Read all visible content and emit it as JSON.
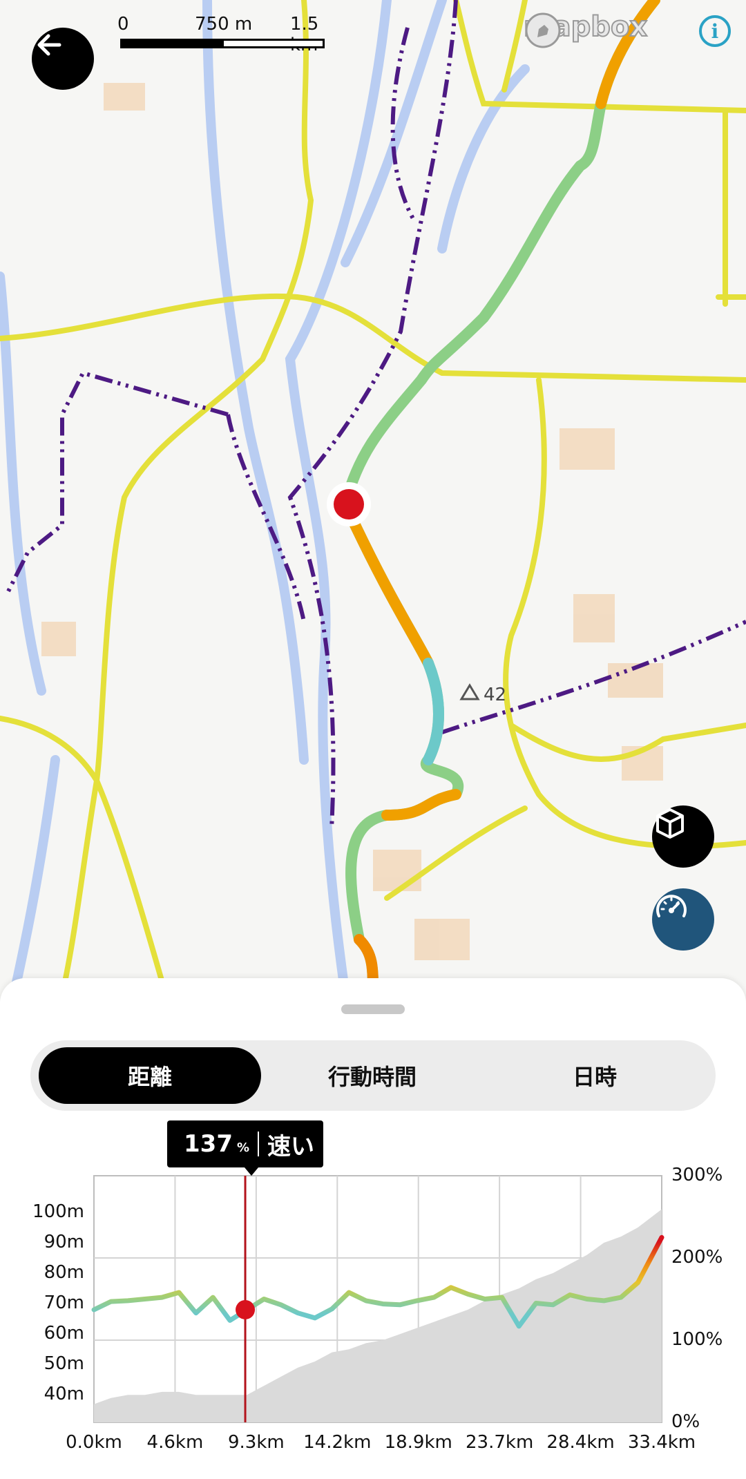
{
  "map": {
    "scale": {
      "labels": [
        "0",
        "750 m",
        "1.5 km"
      ]
    },
    "attribution": {
      "logo_text": "mapbox",
      "info_icon": "info-icon"
    },
    "landmark": {
      "icon": "triangle-peak-icon",
      "label": "42"
    },
    "buttons": {
      "back": "arrow-left-icon",
      "view3d": "cube-icon",
      "speed": "speedometer-icon"
    }
  },
  "sheet": {
    "tabs": [
      {
        "label": "距離",
        "active": true
      },
      {
        "label": "行動時間",
        "active": false
      },
      {
        "label": "日時",
        "active": false
      }
    ],
    "tooltip": {
      "percent": "137",
      "unit": "%",
      "speed_label": "速い"
    }
  },
  "chart_data": {
    "type": "line",
    "x_labels": [
      "0.0km",
      "4.6km",
      "9.3km",
      "14.2km",
      "18.9km",
      "23.7km",
      "28.4km",
      "33.4km"
    ],
    "y_left_labels": [
      "100m",
      "90m",
      "80m",
      "70m",
      "60m",
      "50m",
      "40m"
    ],
    "y_right_labels": [
      "300%",
      "200%",
      "100%",
      "0%"
    ],
    "xlim_km": [
      0,
      33.4
    ],
    "ylim_left_m": [
      31,
      112
    ],
    "ylim_right_pct": [
      0,
      300
    ],
    "cursor_km": 8.9,
    "cursor_pct": 137,
    "series": [
      {
        "axis": "right",
        "km": [
          0,
          1,
          2,
          3,
          4,
          5,
          6,
          7,
          8,
          9,
          10,
          11,
          12,
          13,
          14,
          15,
          16,
          17,
          18,
          19,
          20,
          21,
          22,
          23,
          24,
          25,
          26,
          27,
          28,
          29,
          30,
          31,
          32,
          33.4
        ],
        "pct": [
          137,
          147,
          148,
          150,
          152,
          158,
          133,
          152,
          124,
          137,
          150,
          143,
          133,
          127,
          138,
          158,
          148,
          144,
          143,
          148,
          152,
          164,
          156,
          150,
          152,
          117,
          145,
          143,
          155,
          150,
          148,
          152,
          170,
          225
        ]
      },
      {
        "axis": "left",
        "km": [
          0,
          1,
          2,
          3,
          4,
          5,
          6,
          7,
          8,
          9,
          10,
          11,
          12,
          13,
          14,
          15,
          16,
          17,
          18,
          19,
          20,
          21,
          22,
          23,
          24,
          25,
          26,
          27,
          28,
          29,
          30,
          31,
          32,
          33.4
        ],
        "m": [
          37,
          39,
          40,
          40,
          41,
          41,
          40,
          40,
          40,
          40,
          43,
          46,
          49,
          51,
          54,
          55,
          57,
          58,
          60,
          62,
          64,
          66,
          68,
          71,
          73,
          75,
          78,
          80,
          83,
          86,
          90,
          92,
          95,
          101
        ]
      }
    ]
  }
}
